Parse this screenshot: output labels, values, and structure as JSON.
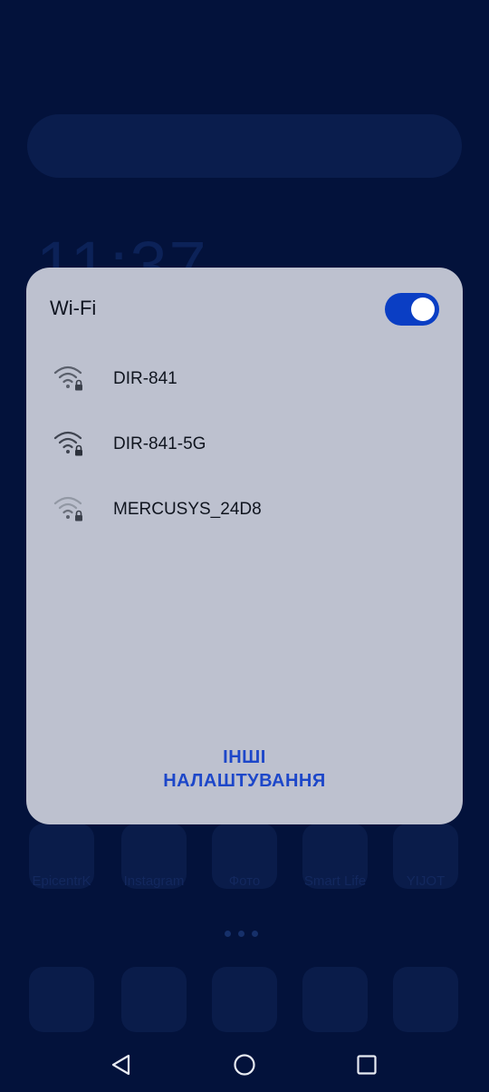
{
  "wifi_dialog": {
    "title": "Wi-Fi",
    "toggle_on": true,
    "networks": [
      {
        "name": "DIR-841",
        "signal": "strong",
        "secured": true
      },
      {
        "name": "DIR-841-5G",
        "signal": "strong",
        "secured": true
      },
      {
        "name": "MERCUSYS_24D8",
        "signal": "weak",
        "secured": true
      }
    ],
    "more_settings_line1": "ІНШІ",
    "more_settings_line2": "НАЛАШТУВАННЯ"
  },
  "background": {
    "clock": "11:37",
    "dock_labels": [
      "EpicentrK",
      "Instagram",
      "Фото",
      "Smart Life",
      "YIJOT"
    ]
  },
  "nav_bar": {
    "back_icon": "back-triangle-icon",
    "home_icon": "home-circle-icon",
    "recents_icon": "recents-square-icon"
  },
  "colors": {
    "accent": "#1d47c9",
    "toggle": "#0a3ec4",
    "dialog_bg": "#bdc1cf",
    "screen_bg": "#03123b"
  }
}
